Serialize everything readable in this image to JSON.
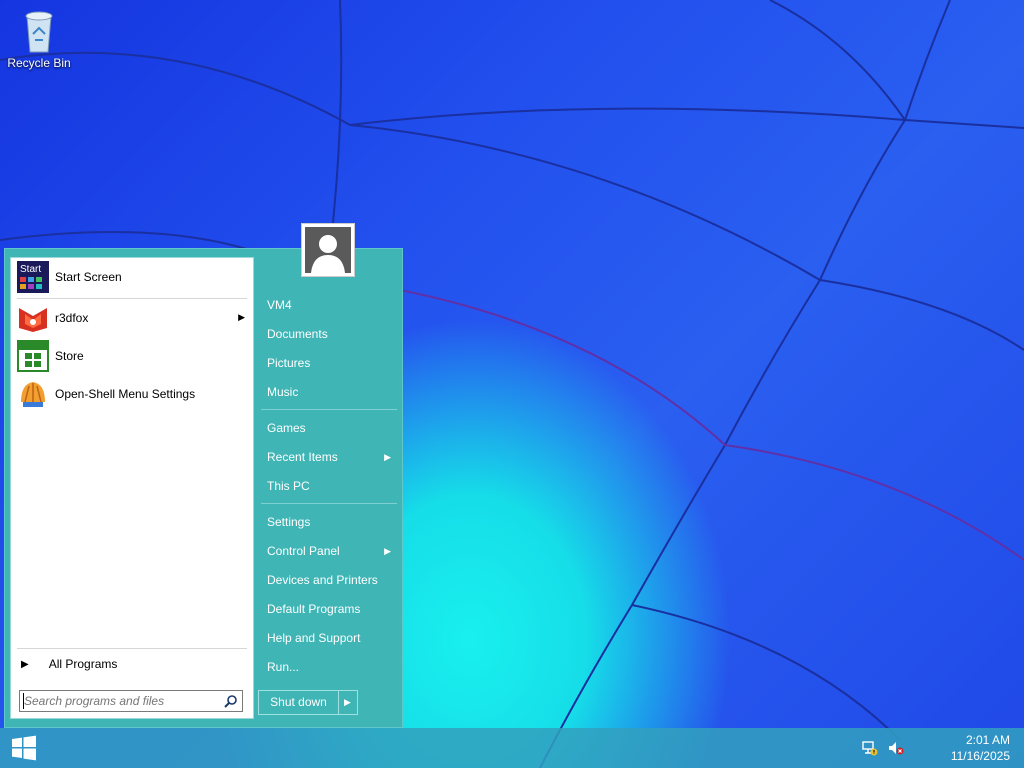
{
  "desktop": {
    "recycle_bin_label": "Recycle Bin"
  },
  "start_menu": {
    "programs": [
      {
        "label": "Start Screen",
        "icon": "start-screen-icon"
      },
      {
        "label": "r3dfox",
        "icon": "r3dfox-icon",
        "has_submenu": true
      },
      {
        "label": "Store",
        "icon": "store-icon"
      },
      {
        "label": "Open-Shell Menu Settings",
        "icon": "open-shell-icon"
      }
    ],
    "start_screen_icon_text": "Start",
    "all_programs_label": "All Programs",
    "search": {
      "placeholder": "Search programs and files"
    },
    "user_label": "VM4",
    "right_items": [
      {
        "label": "Documents"
      },
      {
        "label": "Pictures"
      },
      {
        "label": "Music"
      },
      {
        "label": "Games"
      },
      {
        "label": "Recent Items"
      },
      {
        "label": "This PC"
      },
      {
        "label": "Settings"
      },
      {
        "label": "Control Panel"
      },
      {
        "label": "Devices and Printers"
      },
      {
        "label": "Default Programs"
      },
      {
        "label": "Help and Support"
      },
      {
        "label": "Run..."
      }
    ],
    "shutdown_label": "Shut down"
  },
  "taskbar": {
    "time": "2:01 AM",
    "date": "11/16/2025"
  },
  "colors": {
    "menu_bg": "#3fb5b5",
    "taskbar_bg": "#32a0be",
    "desktop_blue": "#2250ee",
    "desktop_cyan": "#19f0ee"
  }
}
